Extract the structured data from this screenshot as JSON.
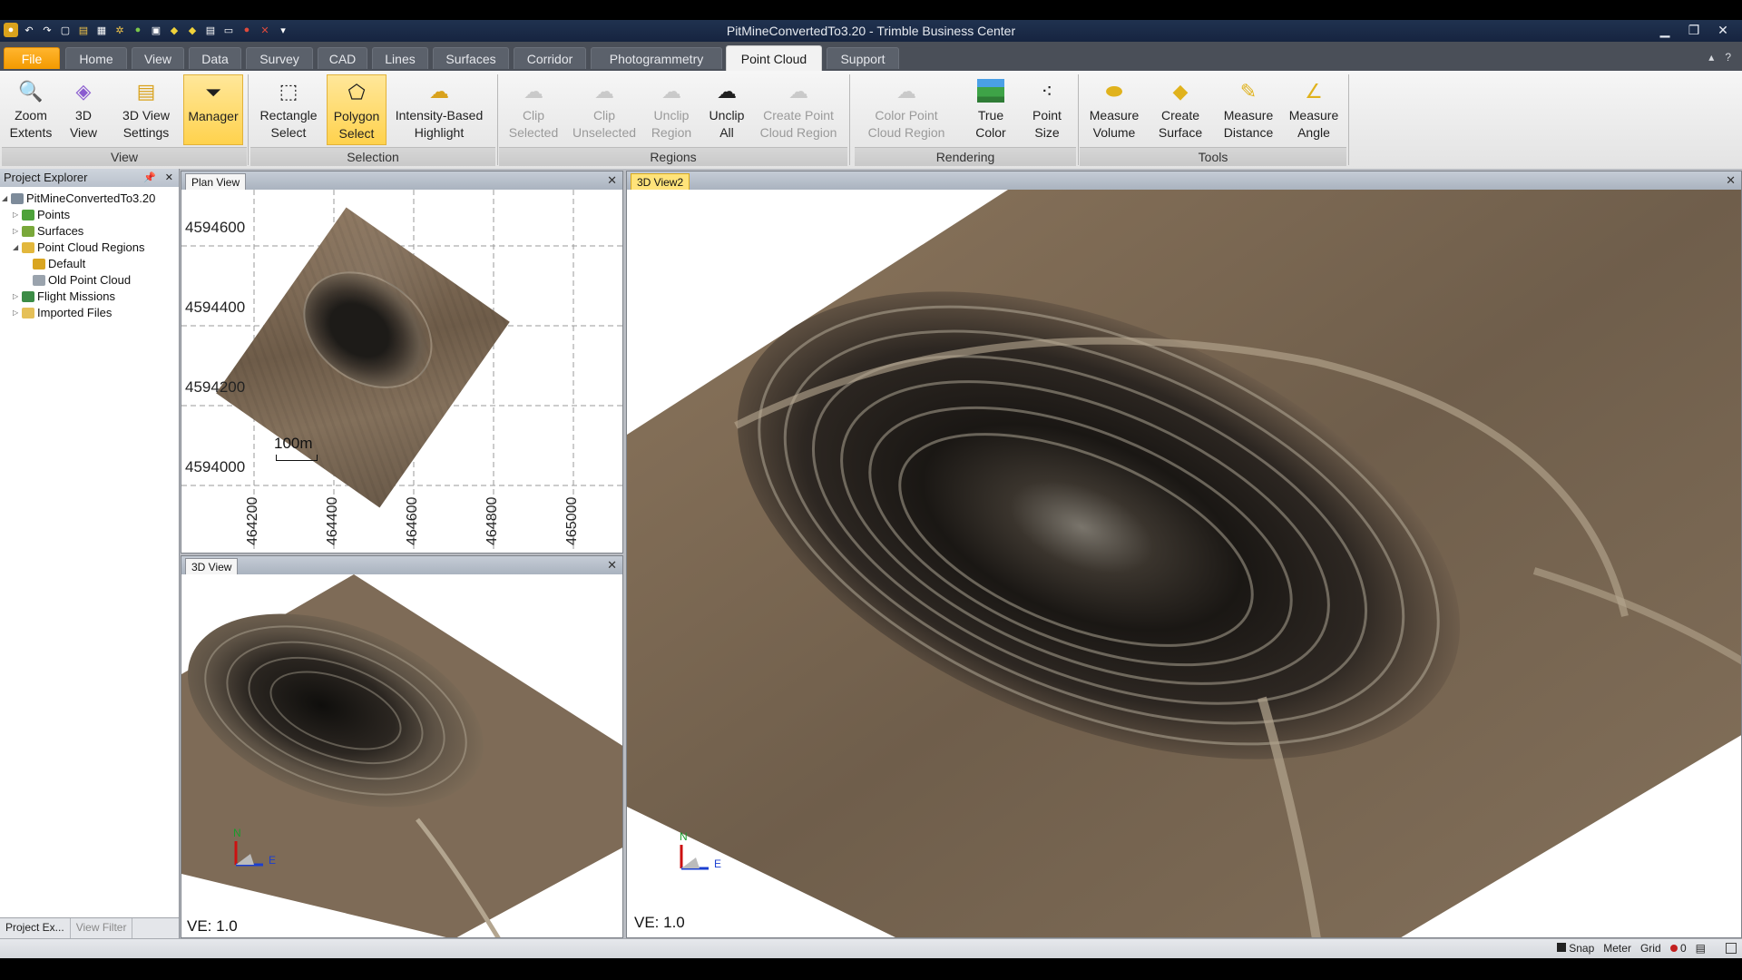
{
  "app": {
    "title": "PitMineConvertedTo3.20 - Trimble Business Center"
  },
  "tabs": [
    "File",
    "Home",
    "View",
    "Data",
    "Survey",
    "CAD",
    "Lines",
    "Surfaces",
    "Corridor",
    "Photogrammetry",
    "Point Cloud",
    "Support"
  ],
  "active_tab": "Point Cloud",
  "ribbon": {
    "view": {
      "group": "View",
      "zoom": "Zoom\nExtents",
      "view3d": "3D\nView",
      "view3d_settings": "3D View\nSettings",
      "manager": "Manager"
    },
    "selection": {
      "group": "Selection",
      "rectangle": "Rectangle\nSelect",
      "polygon": "Polygon\nSelect",
      "intensity": "Intensity-Based\nHighlight"
    },
    "regions": {
      "group": "Regions",
      "clip_selected": "Clip\nSelected",
      "clip_unselected": "Clip\nUnselected",
      "unclip_region": "Unclip\nRegion",
      "unclip_all": "Unclip\nAll",
      "create_region": "Create Point\nCloud Region"
    },
    "rendering": {
      "group": "Rendering",
      "color_region": "Color Point\nCloud Region",
      "true_color": "True\nColor",
      "point_size": "Point\nSize"
    },
    "tools": {
      "group": "Tools",
      "measure_volume": "Measure\nVolume",
      "create_surface": "Create\nSurface",
      "measure_distance": "Measure\nDistance",
      "measure_angle": "Measure\nAngle"
    }
  },
  "explorer": {
    "title": "Project Explorer",
    "items": [
      {
        "label": "PitMineConvertedTo3.20",
        "indent": 0,
        "toggle": "◢",
        "color": "#7d8b9a"
      },
      {
        "label": "Points",
        "indent": 1,
        "toggle": "▷",
        "color": "#4da23a"
      },
      {
        "label": "Surfaces",
        "indent": 1,
        "toggle": "▷",
        "color": "#79a83a"
      },
      {
        "label": "Point Cloud Regions",
        "indent": 1,
        "toggle": "◢",
        "color": "#e2b73c"
      },
      {
        "label": "Default",
        "indent": 2,
        "toggle": "",
        "color": "#d9a520"
      },
      {
        "label": "Old Point Cloud",
        "indent": 2,
        "toggle": "",
        "color": "#9aa3ad"
      },
      {
        "label": "Flight Missions",
        "indent": 1,
        "toggle": "▷",
        "color": "#3c8c46"
      },
      {
        "label": "Imported Files",
        "indent": 1,
        "toggle": "▷",
        "color": "#e5c058"
      }
    ],
    "bottom_tabs": [
      "Project Ex...",
      "View Filter"
    ]
  },
  "plan_view": {
    "tab": "Plan View",
    "y_labels": [
      "4594600",
      "4594400",
      "4594200",
      "4594000"
    ],
    "x_labels": [
      "464200",
      "464400",
      "464600",
      "464800",
      "465000"
    ],
    "scale": "100m"
  },
  "view3d": {
    "tab": "3D View",
    "ve": "VE: 1.0"
  },
  "view3d2": {
    "tab": "3D View2",
    "ve": "VE: 1.0"
  },
  "axes_labels": {
    "north": "N",
    "east": "E"
  },
  "status": {
    "snap": "Snap",
    "unit": "Meter",
    "grid": "Grid",
    "count": "0"
  }
}
